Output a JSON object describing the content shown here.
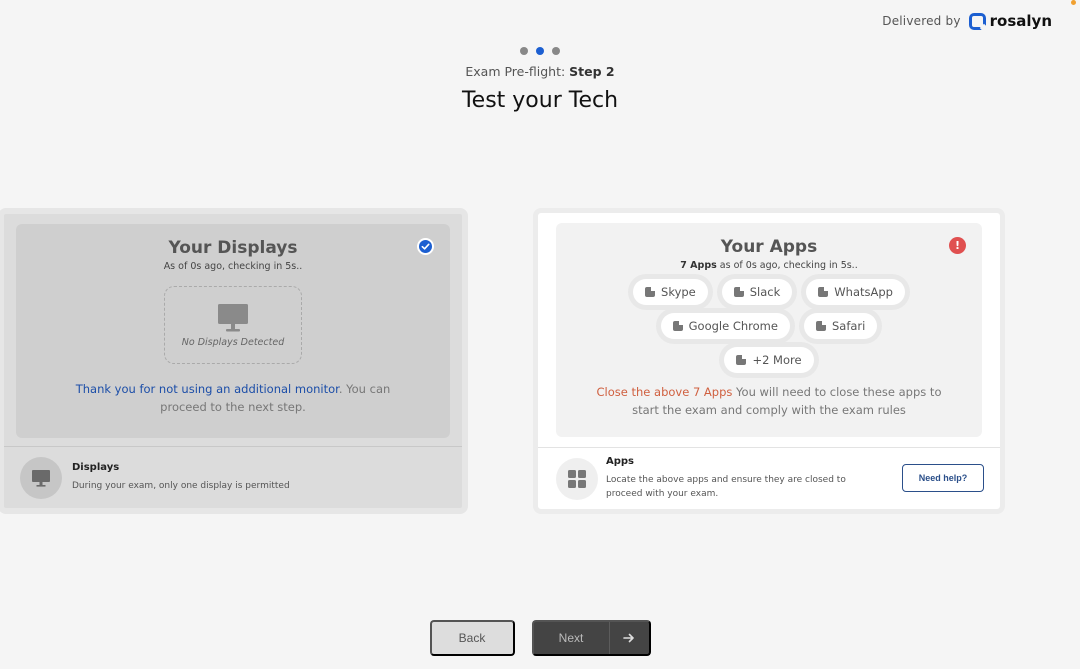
{
  "brand": {
    "delivered_by": "Delivered by",
    "name": "rosalyn"
  },
  "header": {
    "subtitle_prefix": "Exam Pre-flight:",
    "subtitle_step": "Step 2",
    "title": "Test your Tech",
    "steps_total": 3,
    "active_step": 2
  },
  "displays_card": {
    "title": "Your Displays",
    "status_text": "As of 0s ago, checking in 5s..",
    "box_label": "No Displays Detected",
    "msg_highlight": "Thank you for not using an additional monitor",
    "msg_rest": ". You can proceed to the next step.",
    "footer_title": "Displays",
    "footer_desc": "During your exam, only one display is permitted",
    "status_icon": "check-icon"
  },
  "apps_card": {
    "title": "Your Apps",
    "count_label": "7 Apps",
    "status_text": " as of 0s ago, checking in 5s..",
    "apps_row1": [
      "Skype",
      "Slack",
      "WhatsApp"
    ],
    "apps_row2": [
      "Google Chrome",
      "Safari"
    ],
    "more_label": "+2 More",
    "msg_highlight": "Close the above 7 Apps",
    "msg_rest": " You will need to close these apps to start the exam and comply with the exam rules",
    "footer_title": "Apps",
    "footer_desc": "Locate the above apps and ensure they are closed to proceed with your exam.",
    "help_label": "Need help?",
    "status_icon": "exclamation-icon"
  },
  "nav": {
    "back_label": "Back",
    "next_label": "Next"
  },
  "colors": {
    "accent": "#1c5fd1",
    "error": "#e05050",
    "warning_text": "#d06040"
  }
}
